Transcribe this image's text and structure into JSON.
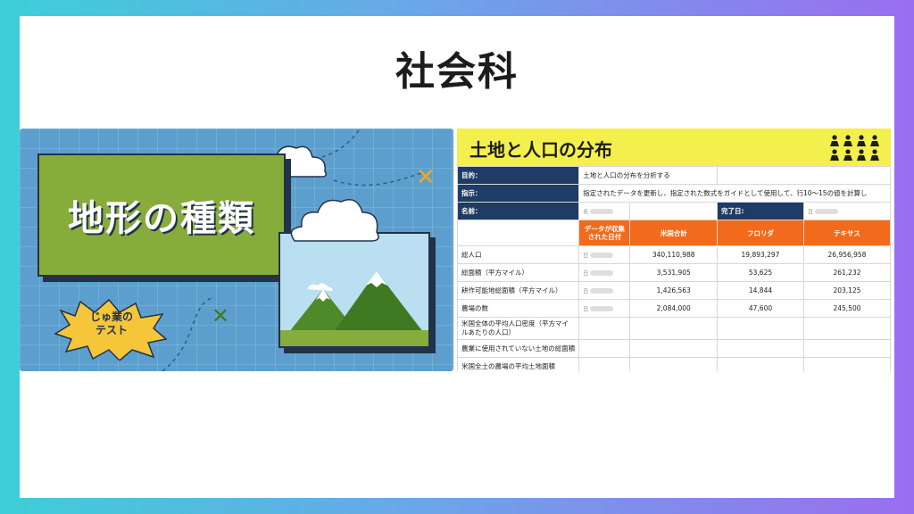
{
  "page": {
    "title": "社会科"
  },
  "illustration": {
    "main_title": "地形の種類",
    "badge_line1": "じゅ業の",
    "badge_line2": "テスト"
  },
  "sheet": {
    "title": "土地と人口の分布",
    "purpose_label": "目的：",
    "purpose_value": "土地と人口の分布を分析する",
    "instructions_label": "指示：",
    "instructions_value": "指定されたデータを更新し、指定された数式をガイドとして使用して、行10〜15の値を計算し",
    "name_label": "名前：",
    "name_placeholder": "名",
    "done_label": "完了日:",
    "date_placeholder": "日",
    "headers": {
      "collected": "データが収集された日付",
      "us_total": "米国合計",
      "florida": "フロリダ",
      "texas": "テキサス"
    },
    "rows": [
      {
        "label": "総人口",
        "date_ph": "日",
        "us": "340,110,988",
        "fl": "19,893,297",
        "tx": "26,956,958"
      },
      {
        "label": "総面積（平方マイル）",
        "date_ph": "日",
        "us": "3,531,905",
        "fl": "53,625",
        "tx": "261,232"
      },
      {
        "label": "耕作可能地総面積（平方マイル）",
        "date_ph": "日",
        "us": "1,426,563",
        "fl": "14,844",
        "tx": "203,125"
      },
      {
        "label": "農場の数",
        "date_ph": "日",
        "us": "2,084,000",
        "fl": "47,600",
        "tx": "245,500"
      }
    ],
    "extra_rows": [
      "米国全体の平均人口密度（平方マイルあたりの人口）",
      "農業に使用されていない土地の総面積",
      "米国全土の農場の平均土地面積"
    ]
  },
  "colors": {
    "navy": "#1f3c66",
    "orange": "#f26a1b",
    "yellow": "#f3ef4d",
    "green_panel": "#86ac3b",
    "bg_blue": "#5c9fce"
  }
}
